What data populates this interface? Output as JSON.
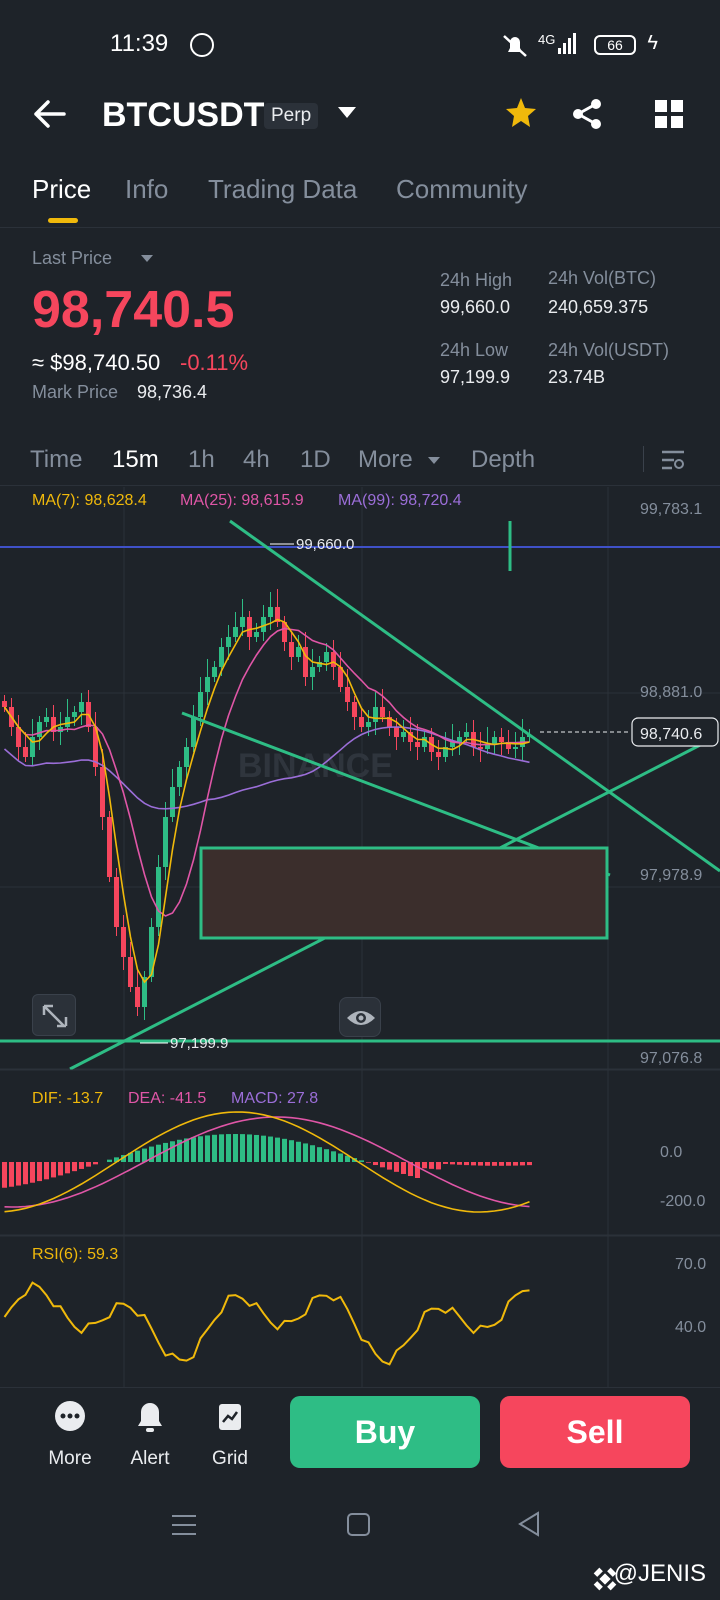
{
  "status": {
    "time": "11:39",
    "network": "4G",
    "battery": "66"
  },
  "header": {
    "symbol": "BTCUSDT",
    "badge": "Perp"
  },
  "tabs": [
    {
      "label": "Price",
      "active": true
    },
    {
      "label": "Info"
    },
    {
      "label": "Trading Data"
    },
    {
      "label": "Community"
    }
  ],
  "ticker": {
    "last_price_label": "Last Price",
    "last_price": "98,740.5",
    "usd_price": "≈ $98,740.50",
    "change": "-0.11%",
    "mark_price_label": "Mark Price",
    "mark_price": "98,736.4",
    "high_label": "24h High",
    "high": "99,660.0",
    "low_label": "24h Low",
    "low": "97,199.9",
    "vol_btc_label": "24h Vol(BTC)",
    "vol_btc": "240,659.375",
    "vol_usdt_label": "24h Vol(USDT)",
    "vol_usdt": "23.74B"
  },
  "timeframes": [
    {
      "label": "Time"
    },
    {
      "label": "15m",
      "active": true
    },
    {
      "label": "1h"
    },
    {
      "label": "4h"
    },
    {
      "label": "1D"
    },
    {
      "label": "More"
    },
    {
      "label": "Depth"
    }
  ],
  "chart": {
    "ma7": "MA(7): 98,628.4",
    "ma25": "MA(25): 98,615.9",
    "ma99": "MA(99): 98,720.4",
    "axis_labels": [
      "99,783.1",
      "98,881.0",
      "97,978.9",
      "97,076.8"
    ],
    "current_price_tag": "98,740.6",
    "high_marker": "99,660.0",
    "low_marker": "97,199.9",
    "watermark_text": "BINANCE",
    "colors": {
      "up": "#2ebd85",
      "down": "#f6465d",
      "ma7": "#f0b90b",
      "ma25": "#e056a7",
      "ma99": "#9b6ed8"
    }
  },
  "macd": {
    "dif": "DIF: -13.7",
    "dea": "DEA: -41.5",
    "macd": "MACD: 27.8",
    "axis_labels": [
      "0.0",
      "-200.0"
    ]
  },
  "rsi": {
    "label": "RSI(6): 59.3",
    "axis_labels": [
      "70.0",
      "40.0"
    ]
  },
  "bottom": {
    "more": "More",
    "alert": "Alert",
    "grid": "Grid",
    "buy": "Buy",
    "sell": "Sell"
  },
  "watermark": "@JENIS"
}
